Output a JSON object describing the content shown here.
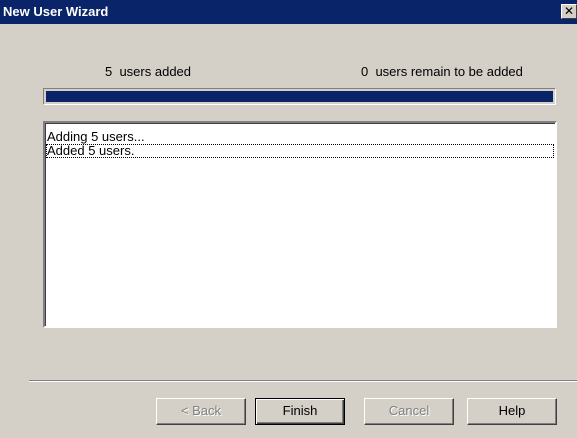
{
  "window": {
    "title": "New User Wizard",
    "close_glyph": "✕"
  },
  "status": {
    "added_text": "5  users added",
    "remaining_text": "0  users remain to be added"
  },
  "progress": {
    "percent": 100,
    "fill_color": "#0a246a"
  },
  "log": {
    "items": [
      "Adding 5 users...",
      "Added 5 users."
    ]
  },
  "buttons": {
    "back_label": "< Back",
    "finish_label": "Finish",
    "cancel_label": "Cancel",
    "help_label": "Help"
  },
  "colors": {
    "titlebar": "#0a246a",
    "dialog_bg": "#d4d0c8"
  }
}
